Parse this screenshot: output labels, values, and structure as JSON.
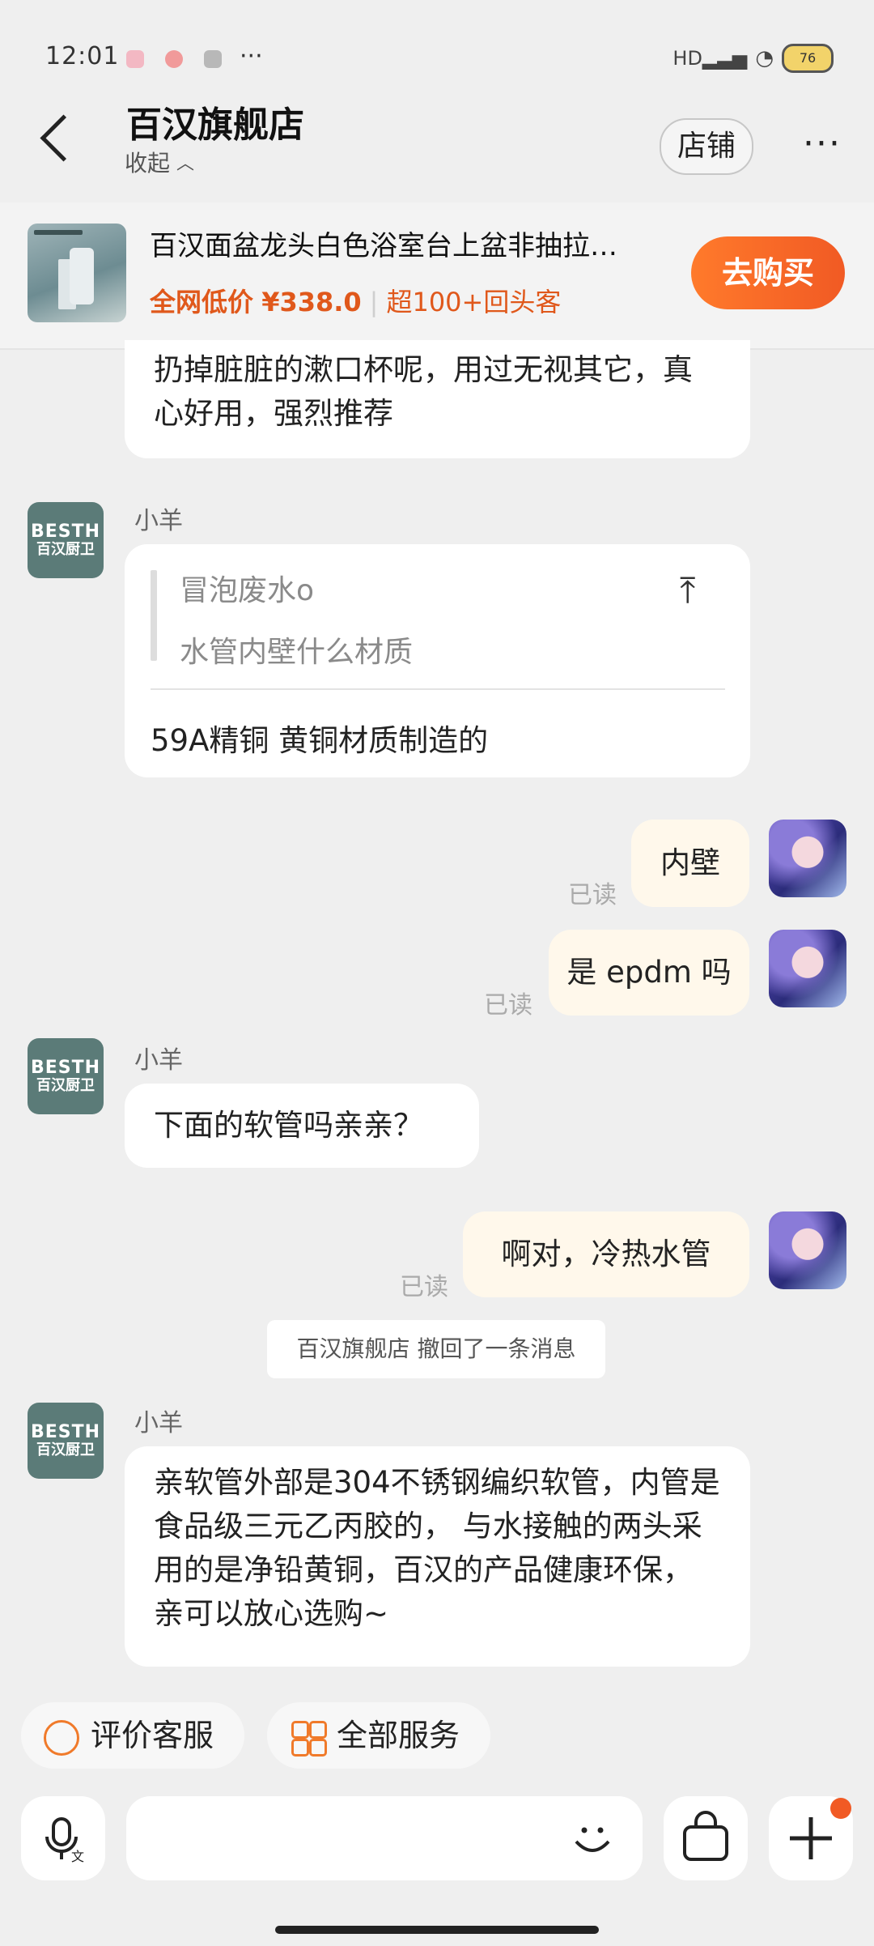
{
  "status_bar": {
    "time": "12:01",
    "dots": "···",
    "battery": "76"
  },
  "header": {
    "title": "百汉旗舰店",
    "collapse": "收起",
    "shop_button": "店铺",
    "more": "···"
  },
  "product": {
    "title": "百汉面盆龙头白色浴室台上盆非抽拉…",
    "price_label": "全网低价",
    "price": "¥338.0",
    "repeat": "超100+回头客",
    "buy_button": "去购买"
  },
  "messages": {
    "m0": "扔掉脏脏的漱口杯呢，用过无视其它，真心好用，强烈推荐",
    "sender": "小羊",
    "avatar_shop_l1": "BESTH",
    "avatar_shop_l2": "百汉厨卫",
    "quote_line1": "冒泡废水o",
    "quote_line2": "水管内壁什么材质",
    "reply1": "59A精铜 黄铜材质制造的",
    "mine1": "内壁",
    "mine2": "是 epdm 吗",
    "shop2": "下面的软管吗亲亲？",
    "mine3": "啊对，冷热水管",
    "read": "已读",
    "recall": "百汉旗舰店 撤回了一条消息",
    "shop3": "亲软管外部是304不锈钢编织软管，内管是食品级三元乙丙胶的， 与水接触的两头采用的是净铅黄铜，百汉的产品健康环保，亲可以放心选购~"
  },
  "bottom": {
    "rate_service": "评价客服",
    "all_services": "全部服务"
  },
  "icons": {
    "accent": "#f07a2a",
    "buy_gradient": [
      "#ff7a2b",
      "#f15a24"
    ]
  }
}
